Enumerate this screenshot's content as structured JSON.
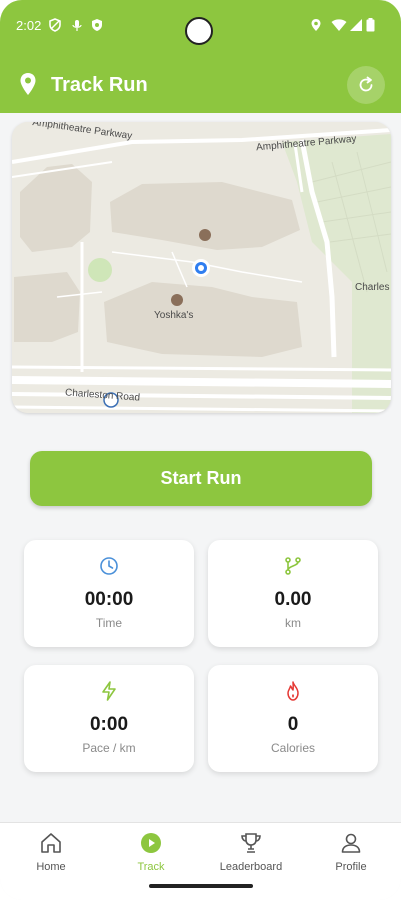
{
  "status_bar": {
    "time": "2:02"
  },
  "header": {
    "title": "Track Run"
  },
  "map": {
    "labels": {
      "road_top_left": "Amphitheatre Parkway",
      "road_top_right": "Amphitheatre Parkway",
      "place": "Yoshka's",
      "road_bottom": "Charleston Road",
      "road_right": "Charles"
    }
  },
  "start_button": {
    "label": "Start Run"
  },
  "stats": [
    {
      "value": "00:00",
      "label": "Time",
      "icon": "clock-icon"
    },
    {
      "value": "0.00",
      "label": "km",
      "icon": "route-icon"
    },
    {
      "value": "0:00",
      "label": "Pace / km",
      "icon": "bolt-icon"
    },
    {
      "value": "0",
      "label": "Calories",
      "icon": "flame-icon"
    }
  ],
  "nav": [
    {
      "label": "Home",
      "icon": "home-icon",
      "active": false
    },
    {
      "label": "Track",
      "icon": "play-icon",
      "active": true
    },
    {
      "label": "Leaderboard",
      "icon": "trophy-icon",
      "active": false
    },
    {
      "label": "Profile",
      "icon": "user-icon",
      "active": false
    }
  ],
  "colors": {
    "accent": "#8dc63f",
    "route_icon": "#8dc63f",
    "bolt_icon": "#8dc63f",
    "clock_icon": "#4a90d9",
    "flame_icon": "#e53935"
  }
}
